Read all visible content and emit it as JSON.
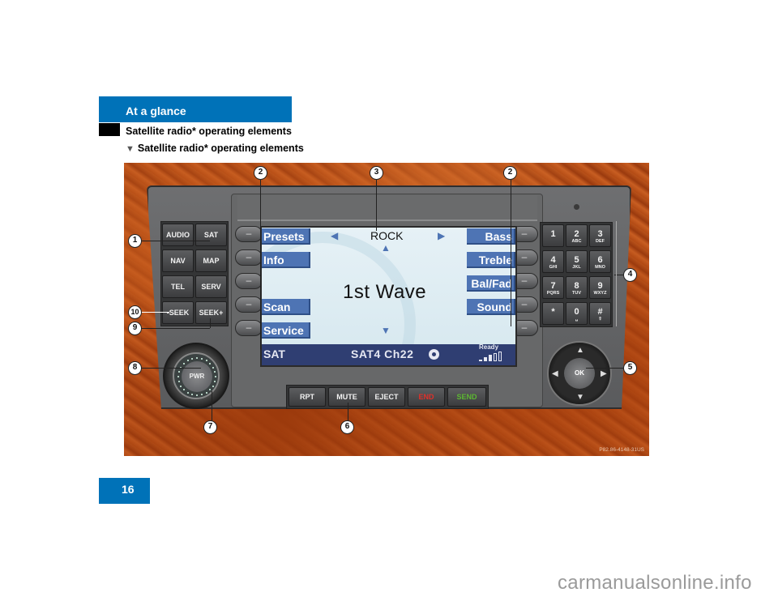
{
  "header": {
    "section": "At a glance",
    "title": "Satellite radio* operating elements",
    "subtitle": "Satellite radio* operating elements",
    "subtitle_icon": "triangle-down-icon"
  },
  "page_number": "16",
  "watermark": "carmanualsonline.info",
  "figure": {
    "photo_id": "P82.86-4148-31US",
    "left_buttons": [
      {
        "label": "AUDIO"
      },
      {
        "label": "SAT"
      },
      {
        "label": "NAV"
      },
      {
        "label": "MAP"
      },
      {
        "label": "TEL"
      },
      {
        "label": "SERV"
      },
      {
        "label": "-SEEK"
      },
      {
        "label": "SEEK+"
      }
    ],
    "power_knob": "PWR",
    "soft_key_glyph": "–",
    "screen": {
      "left_softkeys": [
        "Presets",
        "Info",
        "",
        "Scan",
        "Service"
      ],
      "right_softkeys": [
        "Bass",
        "Treble",
        "Bal/Fad",
        "Sound",
        ""
      ],
      "genre": "ROCK",
      "station": "1st Wave",
      "status": {
        "mode": "SAT",
        "channel": "SAT4  Ch22",
        "ready": "Ready",
        "signal_level": "3 of 5"
      }
    },
    "bottom_buttons": [
      {
        "label": "RPT",
        "color": "#f2f2f2"
      },
      {
        "label": "MUTE",
        "color": "#f2f2f2"
      },
      {
        "label": "EJECT",
        "color": "#f2f2f2"
      },
      {
        "label": "END",
        "color": "#e0302a"
      },
      {
        "label": "SEND",
        "color": "#5db832"
      }
    ],
    "keypad": [
      {
        "n": "1",
        "l": ""
      },
      {
        "n": "2",
        "l": "ABC"
      },
      {
        "n": "3",
        "l": "DEF"
      },
      {
        "n": "4",
        "l": "GHI"
      },
      {
        "n": "5",
        "l": "JKL"
      },
      {
        "n": "6",
        "l": "MNO"
      },
      {
        "n": "7",
        "l": "PQRS"
      },
      {
        "n": "8",
        "l": "TUV"
      },
      {
        "n": "9",
        "l": "WXYZ"
      },
      {
        "n": "*",
        "l": ""
      },
      {
        "n": "0",
        "l": "␣"
      },
      {
        "n": "#",
        "l": "⇧"
      }
    ],
    "nav_ok": "OK",
    "callouts": [
      "1",
      "2",
      "3",
      "2",
      "4",
      "5",
      "6",
      "7",
      "8",
      "9",
      "10"
    ]
  }
}
